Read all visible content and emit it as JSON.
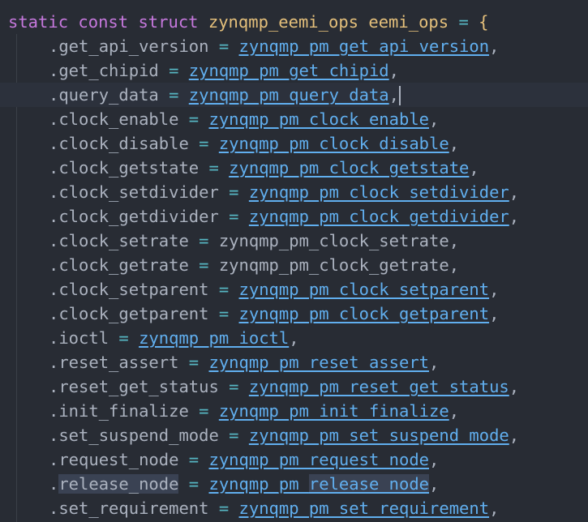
{
  "header": {
    "kw_static": "static",
    "kw_const": "const",
    "kw_struct": "struct",
    "type_name": "zynqmp_eemi_ops",
    "var_name": "eemi_ops",
    "op": "=",
    "brace": "{"
  },
  "members": [
    {
      "field": ".get_api_version",
      "value": "zynqmp_pm_get_api_version",
      "linked": true
    },
    {
      "field": ".get_chipid",
      "value": "zynqmp_pm_get_chipid",
      "linked": true
    },
    {
      "field": ".query_data",
      "value": "zynqmp_pm_query_data",
      "linked": true
    },
    {
      "field": ".clock_enable",
      "value": "zynqmp_pm_clock_enable",
      "linked": true
    },
    {
      "field": ".clock_disable",
      "value": "zynqmp_pm_clock_disable",
      "linked": true
    },
    {
      "field": ".clock_getstate",
      "value": "zynqmp_pm_clock_getstate",
      "linked": true
    },
    {
      "field": ".clock_setdivider",
      "value": "zynqmp_pm_clock_setdivider",
      "linked": true
    },
    {
      "field": ".clock_getdivider",
      "value": "zynqmp_pm_clock_getdivider",
      "linked": true
    },
    {
      "field": ".clock_setrate",
      "value": "zynqmp_pm_clock_setrate",
      "linked": false
    },
    {
      "field": ".clock_getrate",
      "value": "zynqmp_pm_clock_getrate",
      "linked": false
    },
    {
      "field": ".clock_setparent",
      "value": "zynqmp_pm_clock_setparent",
      "linked": true
    },
    {
      "field": ".clock_getparent",
      "value": "zynqmp_pm_clock_getparent",
      "linked": true
    },
    {
      "field": ".ioctl",
      "value": "zynqmp_pm_ioctl",
      "linked": true
    },
    {
      "field": ".reset_assert",
      "value": "zynqmp_pm_reset_assert",
      "linked": true
    },
    {
      "field": ".reset_get_status",
      "value": "zynqmp_pm_reset_get_status",
      "linked": true
    },
    {
      "field": ".init_finalize",
      "value": "zynqmp_pm_init_finalize",
      "linked": true
    },
    {
      "field": ".set_suspend_mode",
      "value": "zynqmp_pm_set_suspend_mode",
      "linked": true
    },
    {
      "field": ".request_node",
      "value": "zynqmp_pm_request_node",
      "linked": true
    },
    {
      "field": ".release_node",
      "value": "zynqmp_pm_release_node",
      "linked": true
    },
    {
      "field": ".set_requirement",
      "value": "zynqmp_pm_set_requirement",
      "linked": true
    }
  ],
  "syntax": {
    "assign": "=",
    "comma": ",",
    "highlight_word": "release_node",
    "fn_prefix": "zynqmp_pm_"
  },
  "colors": {
    "background": "#282c34",
    "keyword": "#c678dd",
    "type": "#e5c07b",
    "operator": "#56b6c2",
    "function_link": "#61afef",
    "text": "#abb2bf",
    "current_line": "#2c313c",
    "word_highlight": "#3a4253"
  }
}
